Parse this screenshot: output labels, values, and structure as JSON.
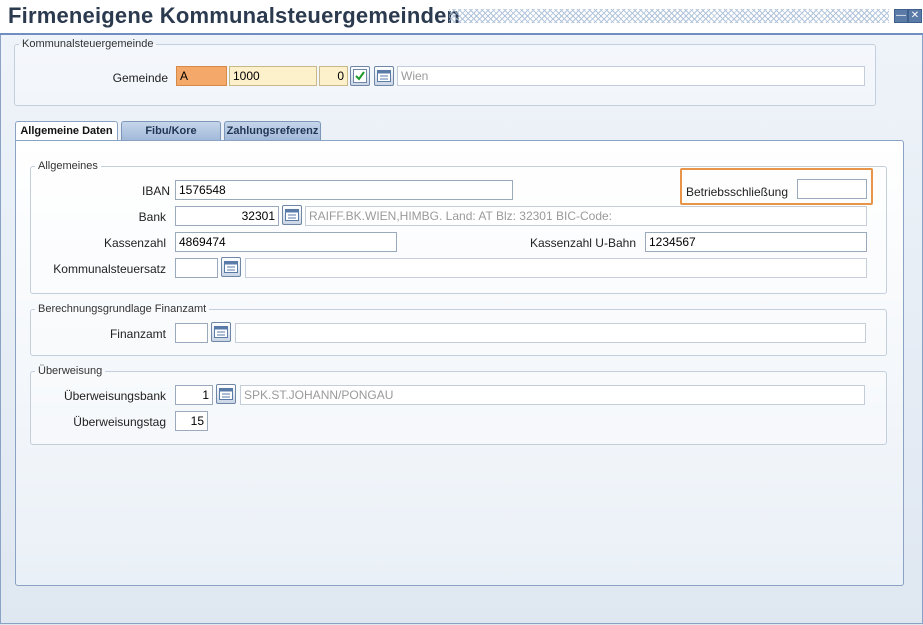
{
  "window": {
    "title": "Firmeneigene Kommunalsteuergemeinden",
    "minimize_icon": "minimize-icon",
    "close_icon": "close-icon"
  },
  "kommunal_group": {
    "legend": "Kommunalsteuergemeinde",
    "gemeinde_label": "Gemeinde",
    "gemeinde_code": "A",
    "gemeinde_number": "1000",
    "gemeinde_index": "0",
    "gemeinde_name": "Wien"
  },
  "tabs": [
    {
      "label": "Allgemeine Daten",
      "active": true
    },
    {
      "label": "Fibu/Kore",
      "active": false
    },
    {
      "label": "Zahlungsreferenz",
      "active": false
    }
  ],
  "allgemeines": {
    "legend": "Allgemeines",
    "iban_label": "IBAN",
    "iban_value": "1576548",
    "betriebsschliessung_label": "Betriebsschließung",
    "betriebsschliessung_value": "",
    "bank_label": "Bank",
    "bank_code": "32301",
    "bank_name": "RAIFF.BK.WIEN,HIMBG. Land: AT Blz: 32301 BIC-Code:",
    "kassenzahl_label": "Kassenzahl",
    "kassenzahl_value": "4869474",
    "kassenzahl_ubahn_label": "Kassenzahl U-Bahn",
    "kassenzahl_ubahn_value": "1234567",
    "kommunalsteuersatz_label": "Kommunalsteuersatz",
    "kommunalsteuersatz_value": "",
    "kommunalsteuersatz_desc": ""
  },
  "berechnung": {
    "legend": "Berechnungsgrundlage Finanzamt",
    "finanzamt_label": "Finanzamt",
    "finanzamt_value": "",
    "finanzamt_desc": ""
  },
  "ueberweisung": {
    "legend": "Überweisung",
    "bank_label": "Überweisungsbank",
    "bank_code": "1",
    "bank_name": "SPK.ST.JOHANN/PONGAU",
    "tag_label": "Überweisungstag",
    "tag_value": "15"
  },
  "colors": {
    "accent": "#6e8fbf",
    "highlight": "#e8954a",
    "gemeinde_code_bg": "#f4a86a",
    "gemeinde_number_bg": "#fdf1cc"
  }
}
